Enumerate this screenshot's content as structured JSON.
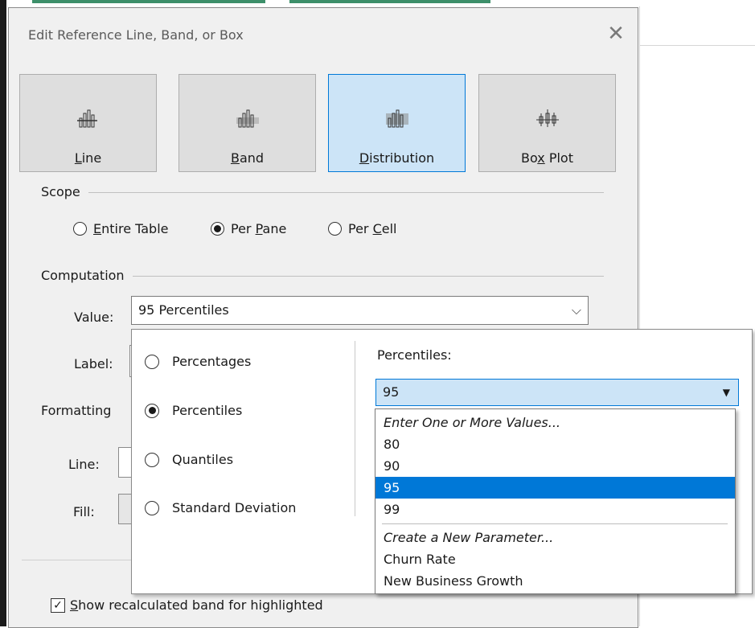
{
  "dialog": {
    "title": "Edit Reference Line, Band, or Box",
    "close": "✕"
  },
  "type_buttons": [
    {
      "label_under": "L",
      "label_rest": "ine"
    },
    {
      "label_under": "B",
      "label_rest": "and"
    },
    {
      "label_under": "D",
      "label_rest": "istribution",
      "selected": true
    },
    {
      "label_pre": "Bo",
      "label_under": "x",
      "label_rest": " Plot"
    }
  ],
  "scope": {
    "heading": "Scope",
    "options": [
      {
        "under": "E",
        "rest": "ntire Table",
        "checked": false
      },
      {
        "pre": "Per ",
        "under": "P",
        "rest": "ane",
        "checked": true
      },
      {
        "pre": "Per ",
        "under": "C",
        "rest": "ell",
        "checked": false
      }
    ]
  },
  "computation": {
    "heading": "Computation",
    "value_label": "Value:",
    "value": "95 Percentiles",
    "label_label": "Label:"
  },
  "formatting": {
    "heading": "Formatting",
    "line_label": "Line:",
    "fill_label": "Fill:"
  },
  "popup": {
    "options": [
      {
        "label": "Percentages",
        "checked": false
      },
      {
        "label": "Percentiles",
        "checked": true
      },
      {
        "label": "Quantiles",
        "checked": false
      },
      {
        "label": "Standard Deviation",
        "checked": false
      }
    ],
    "percentiles_label": "Percentiles:",
    "selected_value": "95"
  },
  "dropdown": {
    "items": [
      {
        "text": "Enter One or More Values...",
        "italic": true
      },
      {
        "text": "80"
      },
      {
        "text": "90"
      },
      {
        "text": "95",
        "highlighted": true
      },
      {
        "text": "99"
      },
      {
        "text": "Create a New Parameter...",
        "italic": true
      },
      {
        "text": "Churn Rate"
      },
      {
        "text": "New Business Growth"
      }
    ]
  },
  "show_recalc": {
    "under": "S",
    "rest": "how recalculated band for highlighted",
    "checked": true,
    "mark": "✓"
  },
  "colors": {
    "accent": "#0078d7",
    "selected_bg": "#cce4f7",
    "dialog_bg": "#f0f0f0"
  }
}
